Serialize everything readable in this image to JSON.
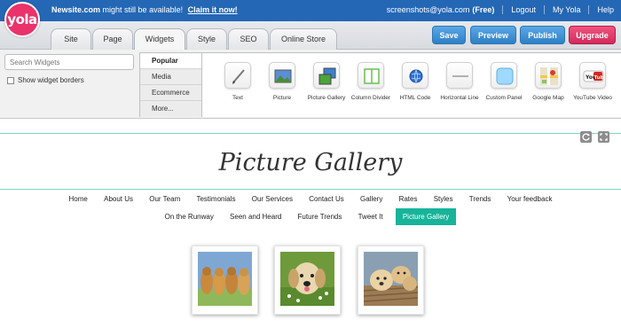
{
  "brand": {
    "logo_text": "yola",
    "logo_color": "#e9336a"
  },
  "topbar": {
    "site_name": "Newsite.com",
    "availability_text": "might still be available!",
    "claim_link": "Claim it now!",
    "account": "screenshots@yola.com",
    "plan": "(Free)",
    "logout": "Logout",
    "my_yola": "My Yola",
    "help": "Help",
    "bg_color": "#2467b5"
  },
  "tabs": [
    {
      "label": "Site"
    },
    {
      "label": "Page"
    },
    {
      "label": "Widgets",
      "active": true
    },
    {
      "label": "Style"
    },
    {
      "label": "SEO"
    },
    {
      "label": "Online Store"
    }
  ],
  "actions": {
    "save": "Save",
    "preview": "Preview",
    "publish": "Publish",
    "upgrade": "Upgrade"
  },
  "widgets_panel": {
    "search_placeholder": "Search Widgets",
    "show_borders_label": "Show widget borders",
    "show_borders_checked": false,
    "categories": [
      "Popular",
      "Media",
      "Ecommerce",
      "More..."
    ],
    "active_category": "Popular",
    "widgets": [
      {
        "label": "Text",
        "icon": "text-pencil-icon"
      },
      {
        "label": "Picture",
        "icon": "picture-icon"
      },
      {
        "label": "Picture Gallery",
        "icon": "picture-gallery-icon"
      },
      {
        "label": "Column Divider",
        "icon": "column-divider-icon"
      },
      {
        "label": "HTML Code",
        "icon": "html-code-globe-icon"
      },
      {
        "label": "Horizontal Line",
        "icon": "horizontal-line-icon"
      },
      {
        "label": "Custom Panel",
        "icon": "custom-panel-icon"
      },
      {
        "label": "Google Map",
        "icon": "google-map-icon"
      },
      {
        "label": "YouTube Video",
        "icon": "youtube-icon"
      }
    ]
  },
  "page": {
    "title": "Picture Gallery",
    "nav_row1": [
      "Home",
      "About Us",
      "Our Team",
      "Testimonials",
      "Our Services",
      "Contact Us",
      "Gallery",
      "Rates",
      "Styles",
      "Trends",
      "Your feedback"
    ],
    "nav_row2": [
      "On the Runway",
      "Seen and Heard",
      "Future Trends",
      "Tweet It",
      "Picture Gallery"
    ],
    "active_nav": "Picture Gallery",
    "accent_color": "#16b49a",
    "gallery": [
      {
        "subject": "four-golden-retrievers-photo"
      },
      {
        "subject": "golden-retriever-on-grass-photo"
      },
      {
        "subject": "retriever-puppies-in-basket-photo"
      }
    ]
  }
}
